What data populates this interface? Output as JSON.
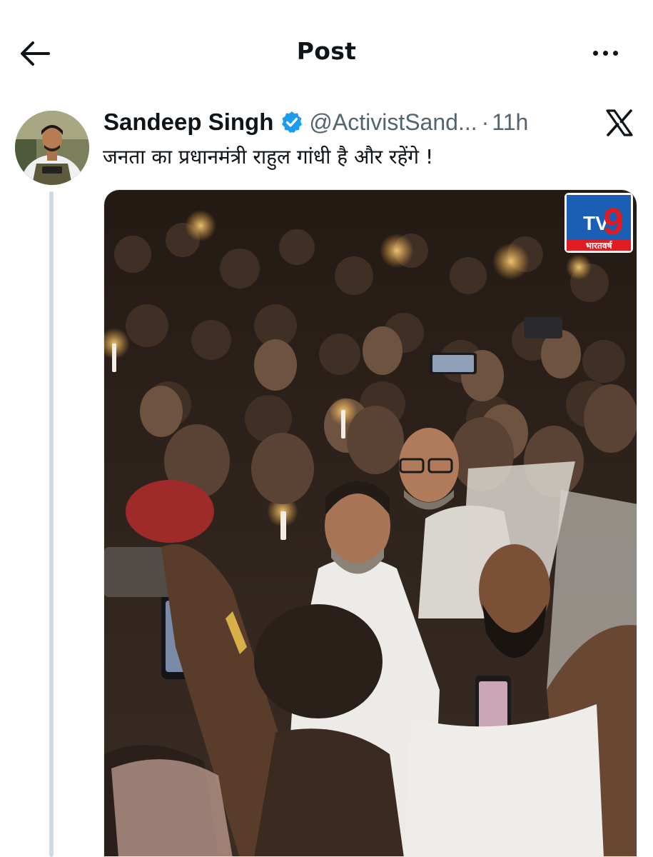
{
  "header": {
    "title": "Post",
    "back_icon": "arrow-left-icon",
    "more_icon": "more-horizontal-icon"
  },
  "tweet": {
    "author_name": "Sandeep Singh",
    "verified_icon": "verified-badge-icon",
    "handle": "@ActivistSand...",
    "separator": "·",
    "time": "11h",
    "platform_icon": "x-logo-icon",
    "text": "जनता का प्रधानमंत्री राहुल गांधी है और रहेंगे !",
    "media": {
      "overlay_logo": {
        "main": "TV9",
        "sub": "भारतवर्ष"
      }
    }
  },
  "colors": {
    "text_primary": "#0f1419",
    "text_secondary": "#536471",
    "verified_blue": "#1d9bf0",
    "thread_line": "#cfd9de",
    "tv9_red": "#e11b22",
    "tv9_blue": "#1a5fb4"
  }
}
